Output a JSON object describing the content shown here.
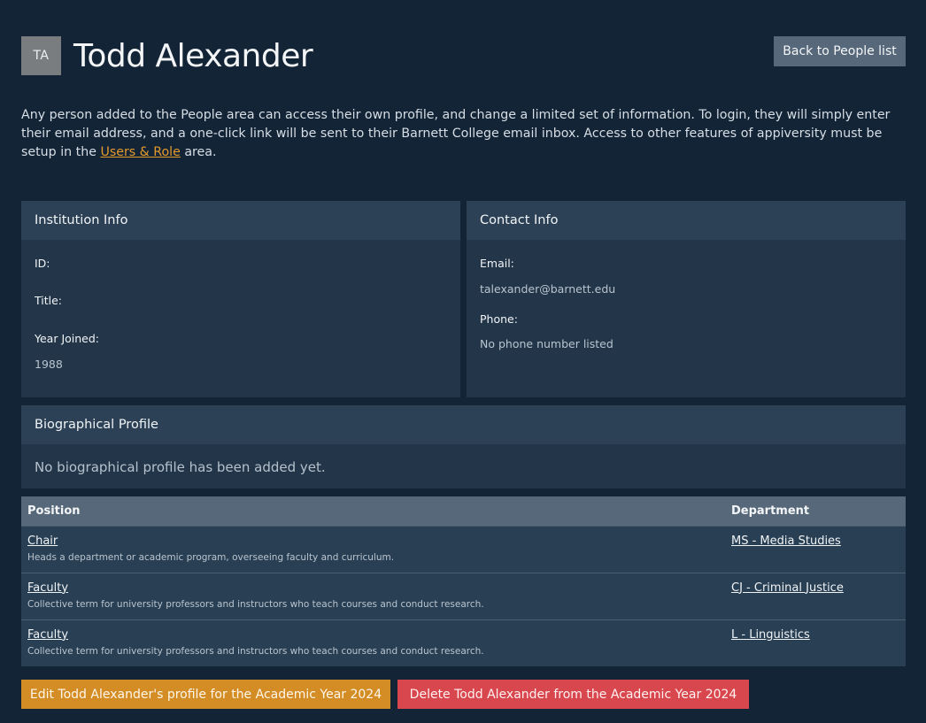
{
  "profile": {
    "initials": "TA",
    "name": "Todd Alexander",
    "back_label": "Back to People list"
  },
  "intro": {
    "text_before": "Any person added to the People area can access their own profile, and change a limited set of information. To login, they will simply enter their email address, and a one-click link will be sent to their Barnett College email inbox. Access to other features of appiversity must be setup in the ",
    "link_label": "Users & Role",
    "text_after": " area."
  },
  "institution": {
    "heading": "Institution Info",
    "id_label": "ID:",
    "id_value": "",
    "title_label": "Title:",
    "title_value": "",
    "year_label": "Year Joined:",
    "year_value": "1988"
  },
  "contact": {
    "heading": "Contact Info",
    "email_label": "Email:",
    "email_value": "talexander@barnett.edu",
    "phone_label": "Phone:",
    "phone_value": "No phone number listed"
  },
  "bio": {
    "heading": "Biographical Profile",
    "empty_text": "No biographical profile has been added yet."
  },
  "positions": {
    "col_position": "Position",
    "col_department": "Department",
    "rows": [
      {
        "position": "Chair",
        "description": "Heads a department or academic program, overseeing faculty and curriculum.",
        "department": "MS - Media Studies"
      },
      {
        "position": "Faculty",
        "description": "Collective term for university professors and instructors who teach courses and conduct research.",
        "department": "CJ - Criminal Justice"
      },
      {
        "position": "Faculty",
        "description": "Collective term for university professors and instructors who teach courses and conduct research.",
        "department": "L - Linguistics"
      }
    ]
  },
  "actions": {
    "edit_label": "Edit Todd Alexander's profile for the Academic Year 2024",
    "delete_label": "Delete Todd Alexander from the Academic Year 2024"
  },
  "colors": {
    "background": "#132436",
    "accent_orange": "#d48c25",
    "danger_red": "#d8474d",
    "link_orange": "#e39a2b"
  }
}
